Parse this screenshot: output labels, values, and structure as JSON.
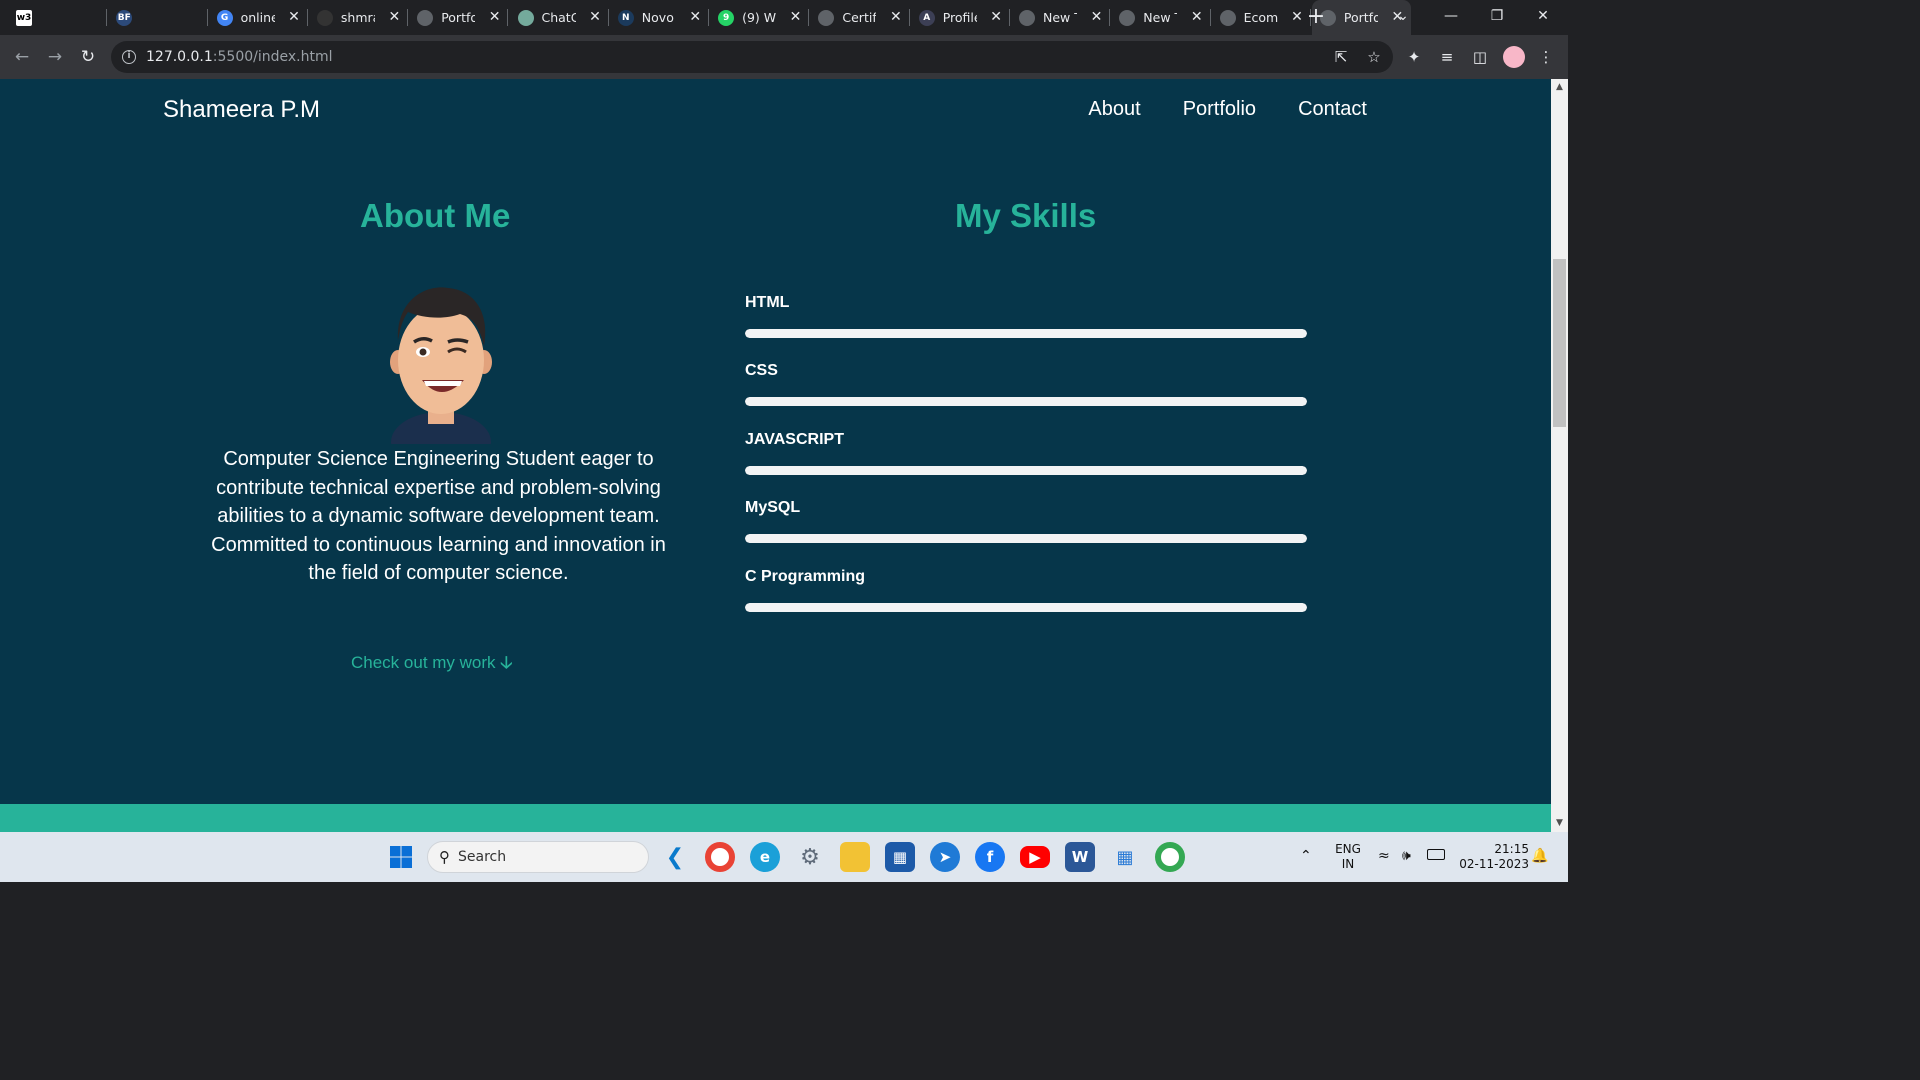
{
  "browser": {
    "tabs": [
      {
        "title": "",
        "favicon": "w3schools-icon",
        "color": "#ffffff",
        "text": "w3"
      },
      {
        "title": "",
        "favicon": "bf-icon",
        "color": "#2c4a7a",
        "text": "BF"
      },
      {
        "title": "online",
        "favicon": "google-icon",
        "color": "#4285f4",
        "text": "G"
      },
      {
        "title": "shmra",
        "favicon": "github-icon",
        "color": "#333333",
        "text": ""
      },
      {
        "title": "Portfo",
        "favicon": "globe-icon",
        "color": "#5f6368",
        "text": ""
      },
      {
        "title": "ChatG",
        "favicon": "chatgpt-icon",
        "color": "#74aa9c",
        "text": ""
      },
      {
        "title": "Novo",
        "favicon": "novo-icon",
        "color": "#1b3a5c",
        "text": "N"
      },
      {
        "title": "(9) W",
        "favicon": "whatsapp-icon",
        "color": "#25d366",
        "text": "9"
      },
      {
        "title": "Certifi",
        "favicon": "globe-icon",
        "color": "#5f6368",
        "text": ""
      },
      {
        "title": "Profile",
        "favicon": "profile-icon",
        "color": "#3c3f55",
        "text": "A"
      },
      {
        "title": "New T",
        "favicon": "chrome-icon",
        "color": "#5f6368",
        "text": ""
      },
      {
        "title": "New T",
        "favicon": "chrome-icon",
        "color": "#5f6368",
        "text": ""
      },
      {
        "title": "Ecom",
        "favicon": "globe-icon",
        "color": "#5f6368",
        "text": ""
      },
      {
        "title": "Portfo",
        "favicon": "globe-icon",
        "color": "#5f6368",
        "text": "",
        "active": true
      }
    ],
    "new_tab": "+",
    "url_host": "127.0.0.1",
    "url_path": ":5500/index.html"
  },
  "site": {
    "brand": "Shameera P.M",
    "nav": [
      "About",
      "Portfolio",
      "Contact"
    ],
    "about_heading": "About Me",
    "skills_heading": "My Skills",
    "about_text": "Computer Science Engineering Student eager to contribute technical expertise and problem-solving abilities to a dynamic software development team. Committed to continuous learning and innovation in the field of computer science.",
    "cta": "Check out my work",
    "skills": [
      {
        "name": "HTML",
        "level": 1.0
      },
      {
        "name": "CSS",
        "level": 1.0
      },
      {
        "name": "JAVASCRIPT",
        "level": 1.0
      },
      {
        "name": "MySQL",
        "level": 1.0
      },
      {
        "name": "C Programming",
        "level": 1.0
      }
    ],
    "accent": "#27b39a",
    "background": "#06364a"
  },
  "taskbar": {
    "search_label": "Search",
    "lang_primary": "ENG",
    "lang_secondary": "IN",
    "time": "21:15",
    "date": "02-11-2023"
  }
}
